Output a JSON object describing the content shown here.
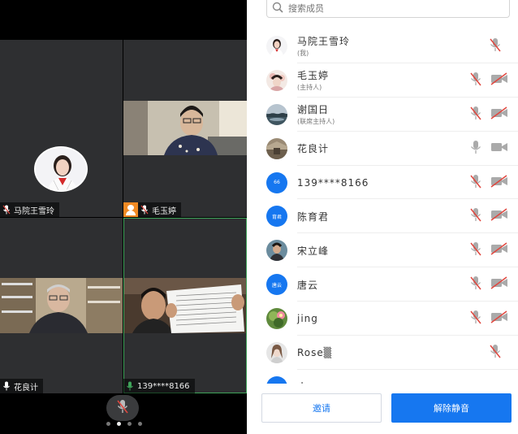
{
  "conference": {
    "tiles": [
      {
        "name": "马院王雪玲",
        "host": false,
        "mic": "muted"
      },
      {
        "name": "毛玉婷",
        "host": true,
        "mic": "muted"
      },
      {
        "name": "花良计",
        "host": false,
        "mic": "on"
      },
      {
        "name": "139****8166",
        "host": false,
        "mic": "speaking"
      }
    ],
    "pager": {
      "pages": 4,
      "current": 2
    }
  },
  "panel": {
    "search_placeholder": "搜索成员",
    "participants": [
      {
        "name": "马院王雪玲",
        "role": "(我)",
        "avatar": "photo",
        "avatar_text": "",
        "mic": "muted",
        "video": "none"
      },
      {
        "name": "毛玉婷",
        "role": "(主持人)",
        "avatar": "photo",
        "avatar_text": "",
        "mic": "muted",
        "video": "off"
      },
      {
        "name": "谢国日",
        "role": "(联席主持人)",
        "avatar": "photo",
        "avatar_text": "",
        "mic": "muted",
        "video": "off"
      },
      {
        "name": "花良计",
        "role": "",
        "avatar": "photo",
        "avatar_text": "",
        "mic": "on",
        "video": "on"
      },
      {
        "name": "139****8166",
        "role": "",
        "avatar": "blue",
        "avatar_text": "66",
        "mic": "muted",
        "video": "off"
      },
      {
        "name": "陈育君",
        "role": "",
        "avatar": "blue",
        "avatar_text": "育君",
        "mic": "muted",
        "video": "off"
      },
      {
        "name": "宋立峰",
        "role": "",
        "avatar": "photo",
        "avatar_text": "",
        "mic": "muted",
        "video": "off"
      },
      {
        "name": "唐云",
        "role": "",
        "avatar": "blue",
        "avatar_text": "唐云",
        "mic": "muted",
        "video": "off"
      },
      {
        "name": "jing",
        "role": "",
        "avatar": "photo",
        "avatar_text": "",
        "mic": "muted",
        "video": "off"
      },
      {
        "name": "Rose▒",
        "role": "",
        "avatar": "photo",
        "avatar_text": "",
        "mic": "muted",
        "video": "none"
      },
      {
        "name": "小",
        "role": "",
        "avatar": "blue",
        "avatar_text": "",
        "mic": "none",
        "video": "none"
      }
    ],
    "invite_label": "邀请",
    "unmute_label": "解除静音"
  },
  "colors": {
    "accent": "#1677f0",
    "mute_red": "#e0473f",
    "host_badge": "#f08a24",
    "speaking_green": "#3fa45a"
  }
}
